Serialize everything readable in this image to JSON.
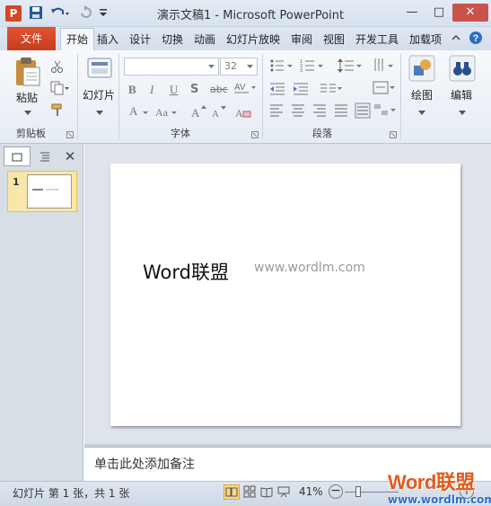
{
  "window": {
    "title": "演示文稿1 - Microsoft PowerPoint",
    "app_icon": "P",
    "minimize": "—",
    "maximize": "□",
    "close": "✕"
  },
  "tabs": {
    "file": "文件",
    "items": [
      "开始",
      "插入",
      "设计",
      "切换",
      "动画",
      "幻灯片放映",
      "审阅",
      "视图",
      "开发工具",
      "加载项"
    ]
  },
  "ribbon": {
    "clipboard": {
      "paste": "粘贴",
      "group": "剪贴板"
    },
    "slides": {
      "new_slide": "幻灯片"
    },
    "font": {
      "name_value": "",
      "size_value": "32",
      "group": "字体"
    },
    "paragraph": {
      "group": "段落"
    },
    "drawing": {
      "label": "绘图"
    },
    "editing": {
      "label": "编辑"
    }
  },
  "left_pane": {
    "slide_number": "1"
  },
  "slide": {
    "title_text": "Word联盟",
    "url_text": "www.wordlm.com"
  },
  "notes": {
    "placeholder": "单击此处添加备注"
  },
  "status": {
    "slide_info": "幻灯片 第 1 张，共 1 张",
    "zoom": "41%",
    "zoom_minus": "−",
    "zoom_plus": "+"
  },
  "watermark": {
    "brand": "Word联盟",
    "url": "www.wordlm.com"
  }
}
